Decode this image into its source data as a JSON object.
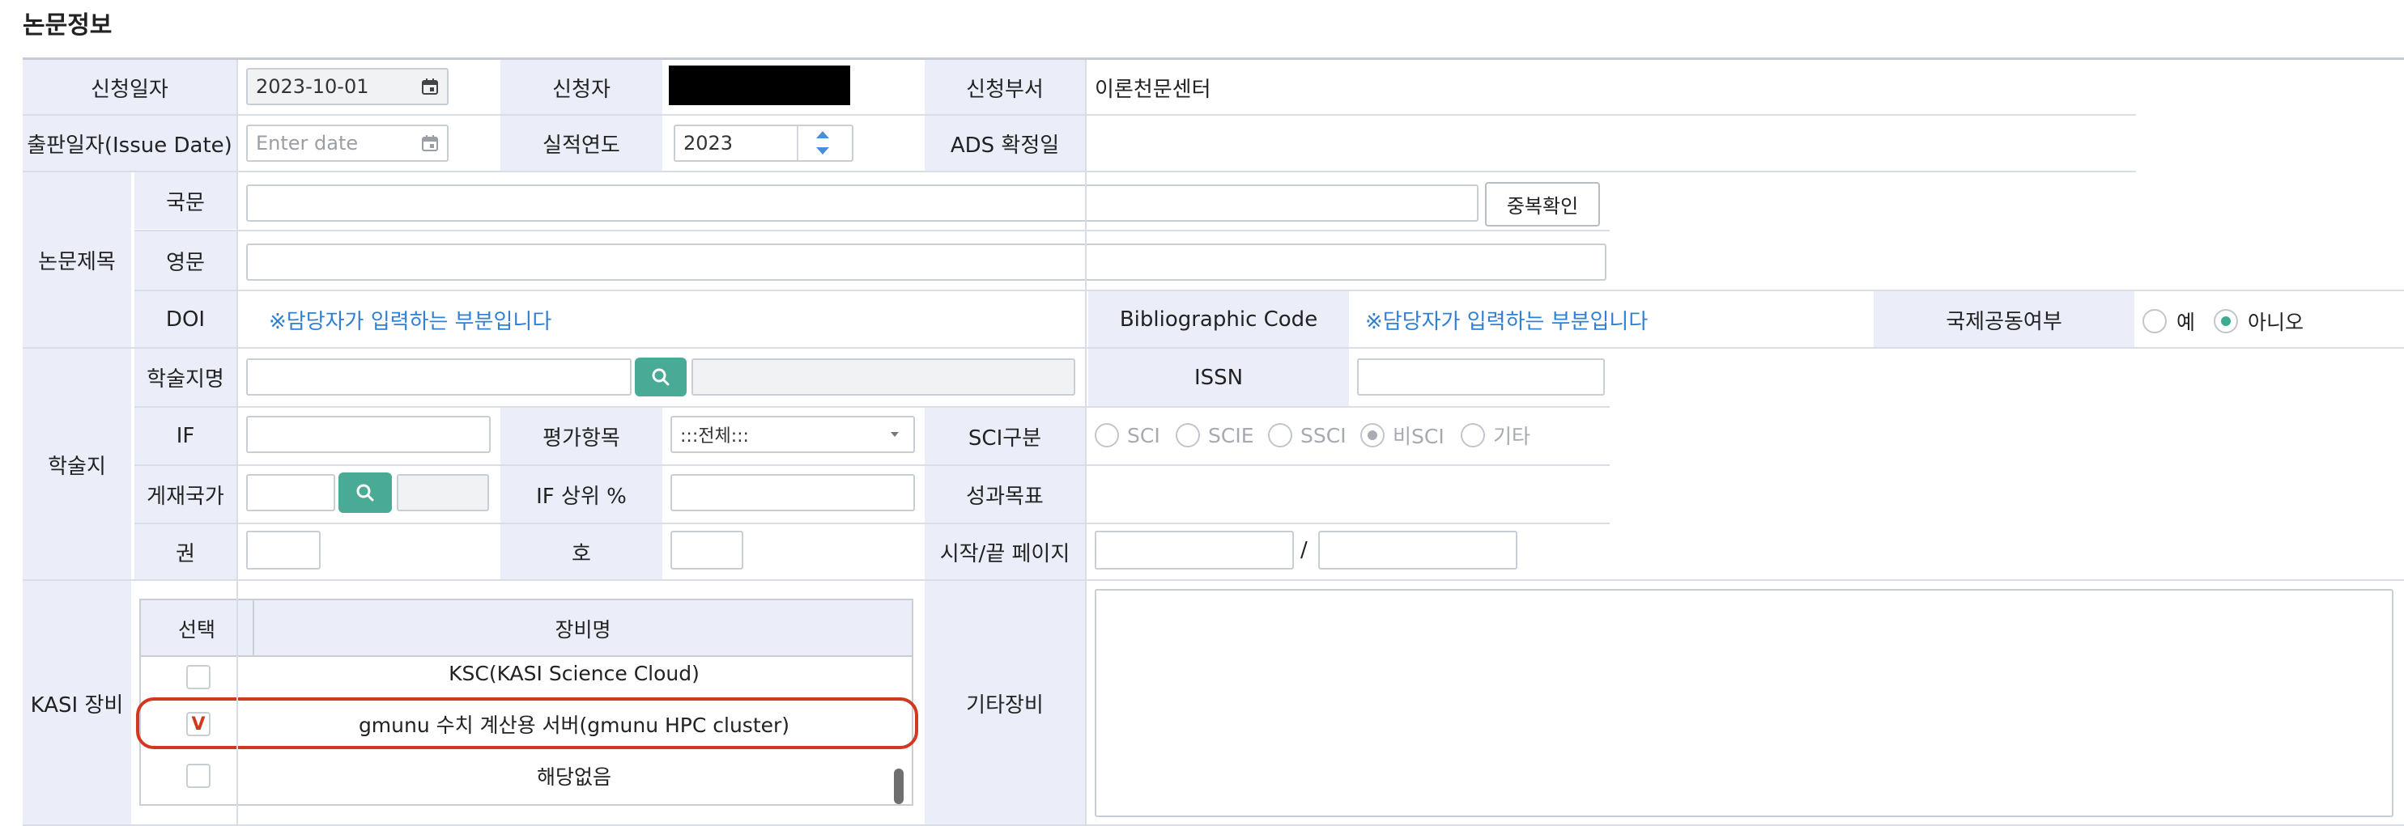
{
  "page_title": "논문정보",
  "row1": {
    "apply_date_label": "신청일자",
    "apply_date_value": "2023-10-01",
    "applicant_label": "신청자",
    "dept_label": "신청부서",
    "dept_value": "이론천문센터"
  },
  "row2": {
    "issue_date_label": "출판일자(Issue Date)",
    "issue_date_placeholder": "Enter date",
    "year_label": "실적연도",
    "year_value": "2023",
    "ads_label": "ADS 확정일"
  },
  "title_section": {
    "label": "논문제목",
    "korean_label": "국문",
    "dup_check_button": "중복확인",
    "english_label": "영문",
    "doi_label": "DOI",
    "doi_note": "※담당자가 입력하는 부분입니다",
    "biblio_label": "Bibliographic Code",
    "biblio_note": "※담당자가 입력하는 부분입니다",
    "intl_label": "국제공동여부",
    "intl_options": [
      "예",
      "아니오"
    ],
    "intl_selected": "아니오"
  },
  "journal_section": {
    "label": "학술지",
    "journal_name_label": "학술지명",
    "issn_label": "ISSN",
    "if_label": "IF",
    "eval_label": "평가항목",
    "eval_value": ":::전체:::",
    "sci_label": "SCI구분",
    "sci_options": [
      "SCI",
      "SCIE",
      "SSCI",
      "비SCI",
      "기타"
    ],
    "sci_selected": "비SCI",
    "country_label": "게재국가",
    "if_rank_label": "IF 상위 %",
    "target_label": "성과목표",
    "volume_label": "권",
    "issue_label": "호",
    "pages_label": "시작/끝 페이지",
    "pages_sep": "/"
  },
  "kasi_section": {
    "label": "KASI 장비",
    "col_select": "선택",
    "col_name": "장비명",
    "rows": [
      {
        "name": "KSC(KASI Science Cloud)",
        "checked": false,
        "mark": ""
      },
      {
        "name": "gmunu 수치 계산용 서버(gmunu HPC cluster)",
        "checked": true,
        "mark": "V"
      },
      {
        "name": "해당없음",
        "checked": false,
        "mark": ""
      }
    ],
    "other_label": "기타장비"
  },
  "colors": {
    "label_bg": "#ebeef8",
    "accent_green": "#49ab96",
    "note_blue": "#2f7fd4",
    "highlight_red": "#d0381f"
  }
}
